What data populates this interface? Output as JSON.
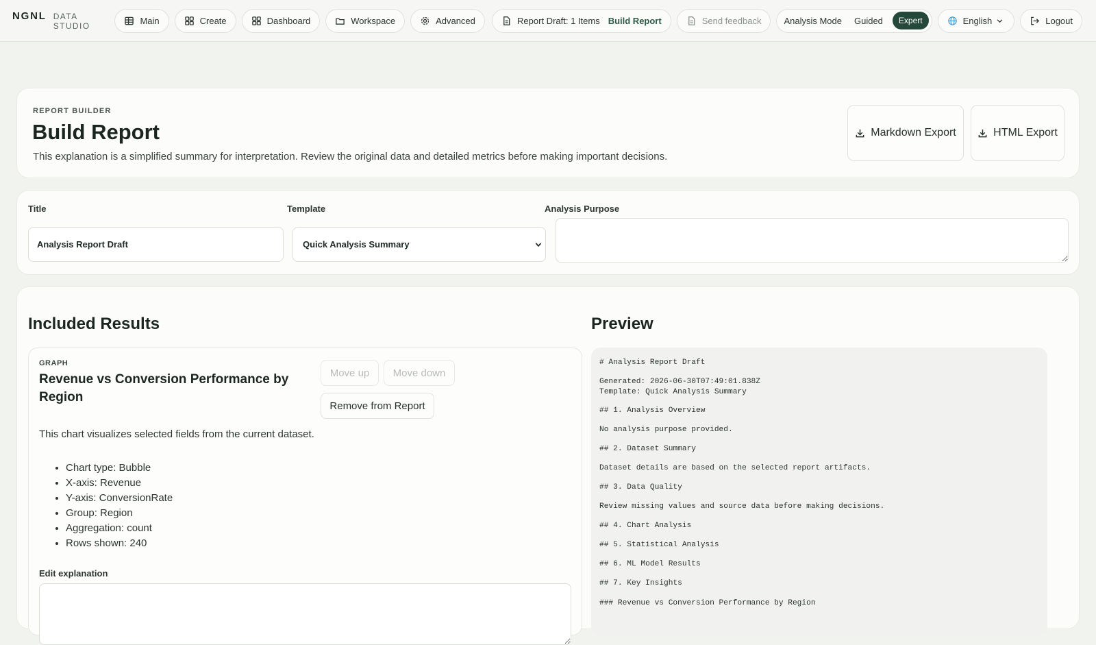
{
  "brand": {
    "name": "NGNL",
    "sub": "DATA STUDIO"
  },
  "nav": {
    "main": "Main",
    "create": "Create",
    "dashboard": "Dashboard",
    "workspace": "Workspace",
    "advanced": "Advanced",
    "draft_status": "Report Draft: 1 Items",
    "draft_link": "Build Report",
    "feedback": "Send feedback",
    "mode_label": "Analysis Mode",
    "mode_guided": "Guided",
    "mode_expert": "Expert",
    "language": "English",
    "logout": "Logout"
  },
  "header": {
    "eyebrow": "REPORT BUILDER",
    "title": "Build Report",
    "subtitle": "This explanation is a simplified summary for interpretation. Review the original data and detailed metrics before making important decisions.",
    "markdown_export": "Markdown Export",
    "html_export": "HTML Export"
  },
  "form": {
    "title_label": "Title",
    "title_value": "Analysis Report Draft",
    "template_label": "Template",
    "template_value": "Quick Analysis Summary",
    "purpose_label": "Analysis Purpose",
    "purpose_value": ""
  },
  "results": {
    "heading": "Included Results",
    "item": {
      "type": "GRAPH",
      "title": "Revenue vs Conversion Performance by Region",
      "move_up": "Move up",
      "move_down": "Move down",
      "remove": "Remove from Report",
      "description": "This chart visualizes selected fields from the current dataset.",
      "details": [
        "Chart type: Bubble",
        "X-axis: Revenue",
        "Y-axis: ConversionRate",
        "Group: Region",
        "Aggregation: count",
        "Rows shown: 240"
      ],
      "edit_label": "Edit explanation"
    }
  },
  "preview": {
    "heading": "Preview",
    "lines": [
      "# Analysis Report Draft",
      "Generated: 2026-06-30T07:49:01.838Z",
      "Template: Quick Analysis Summary",
      "## 1. Analysis Overview",
      "No analysis purpose provided.",
      "## 2. Dataset Summary",
      "Dataset details are based on the selected report artifacts.",
      "## 3. Data Quality",
      "Review missing values and source data before making decisions.",
      "## 4. Chart Analysis",
      "## 5. Statistical Analysis",
      "## 6. ML Model Results",
      "## 7. Key Insights",
      "### Revenue vs Conversion Performance by Region"
    ]
  }
}
